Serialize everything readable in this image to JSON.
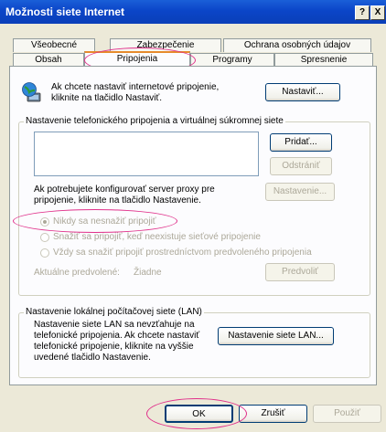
{
  "window": {
    "title": "Možnosti siete Internet",
    "help_btn": "?",
    "close_btn": "X"
  },
  "tabs_back": [
    "Všeobecné",
    "Zabezpečenie",
    "Ochrana osobných údajov"
  ],
  "tabs_front": [
    "Obsah",
    "Pripojenia",
    "Programy",
    "Spresnenie"
  ],
  "setup": {
    "text": "Ak chcete nastaviť internetové pripojenie, kliknite na tlačidlo Nastaviť.",
    "button": "Nastaviť..."
  },
  "dialup": {
    "legend": "Nastavenie telefonického pripojenia a virtuálnej súkromnej siete",
    "add": "Pridať...",
    "remove": "Odstrániť",
    "proxy_text": "Ak potrebujete konfigurovať server proxy pre pripojenie, kliknite na tlačidlo Nastavenie.",
    "settings": "Nastavenie...",
    "radios": [
      "Nikdy sa nesnažiť pripojiť",
      "Snažiť sa pripojiť, keď neexistuje sieťové pripojenie",
      "Vždy sa snažiť pripojiť prostredníctvom predvoleného pripojenia"
    ],
    "current_label": "Aktuálne predvolené:",
    "current_value": "Žiadne",
    "default_btn": "Predvoliť"
  },
  "lan": {
    "legend": "Nastavenie lokálnej počítačovej siete (LAN)",
    "text": "Nastavenie siete LAN sa nevzťahuje na telefonické pripojenia. Ak chcete nastaviť telefonické pripojenie, kliknite na vyššie uvedené tlačidlo Nastavenie.",
    "button": "Nastavenie siete LAN..."
  },
  "footer": {
    "ok": "OK",
    "cancel": "Zrušiť",
    "apply": "Použiť"
  }
}
